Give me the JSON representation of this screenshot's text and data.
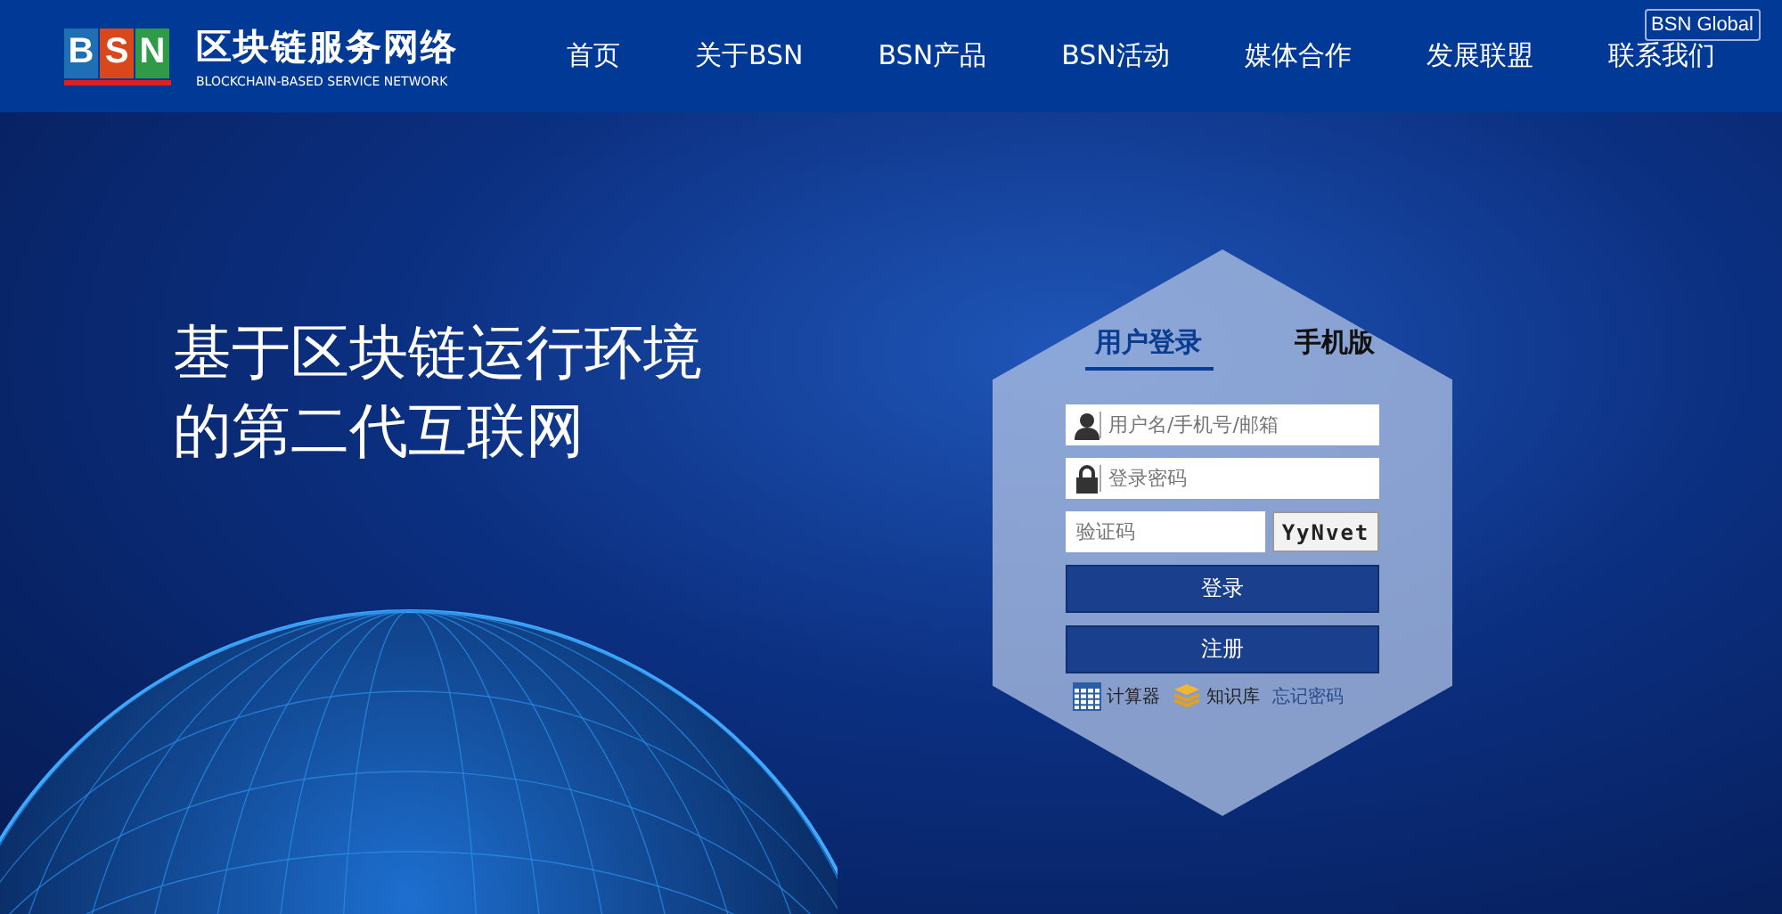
{
  "header": {
    "logo_letters": [
      "B",
      "S",
      "N"
    ],
    "brand_title": "区块链服务网络",
    "brand_subtitle": "BLOCKCHAIN-BASED SERVICE NETWORK",
    "global_button": "BSN Global"
  },
  "nav": [
    {
      "label": "首页"
    },
    {
      "label": "关于BSN"
    },
    {
      "label": "BSN产品"
    },
    {
      "label": "BSN活动"
    },
    {
      "label": "媒体合作"
    },
    {
      "label": "发展联盟"
    },
    {
      "label": "联系我们"
    }
  ],
  "hero": {
    "headline": [
      "基于区块链运行环境",
      "的第二代互联网"
    ]
  },
  "login": {
    "tabs": [
      {
        "label": "用户登录",
        "selected": true
      },
      {
        "label": "手机版",
        "selected": false
      }
    ],
    "fields": [
      {
        "kind": "user",
        "placeholder": "用户名/手机号/邮箱"
      },
      {
        "kind": "lock",
        "placeholder": "登录密码"
      },
      {
        "kind": "captcha",
        "placeholder": "验证码",
        "captcha_text": "YyNvet"
      }
    ],
    "buttons": [
      "登录",
      "注册"
    ],
    "links": [
      {
        "kind": "calculator",
        "label": "计算器"
      },
      {
        "kind": "layers",
        "label": "知识库"
      },
      {
        "kind": "plain",
        "label": "忘记密码"
      }
    ]
  }
}
